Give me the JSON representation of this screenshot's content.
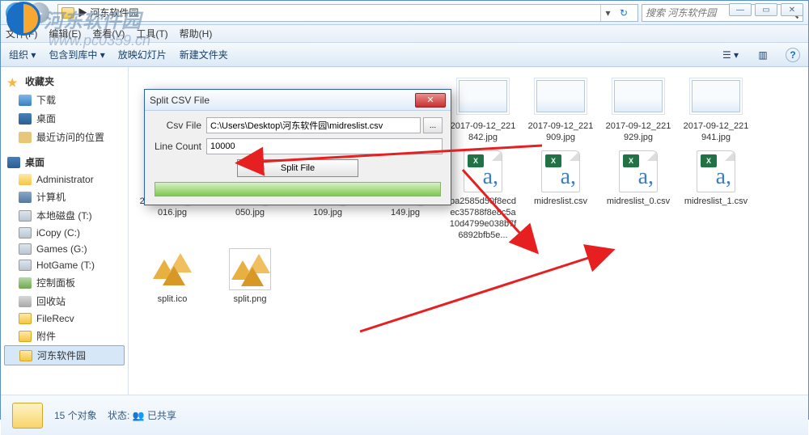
{
  "watermark": {
    "site": "河东软件园",
    "url": "www.pc0359.cn"
  },
  "window": {
    "address": "▶ 河东软件园",
    "search_placeholder": "搜索 河东软件园",
    "menus": [
      "文件(F)",
      "编辑(E)",
      "查看(V)",
      "工具(T)",
      "帮助(H)"
    ],
    "toolbar": {
      "organize": "组织 ▾",
      "include": "包含到库中 ▾",
      "slideshow": "放映幻灯片",
      "newfolder": "新建文件夹"
    }
  },
  "sidebar": {
    "fav": {
      "header": "收藏夹",
      "items": [
        "下载",
        "桌面",
        "最近访问的位置"
      ]
    },
    "desk": {
      "header": "桌面",
      "items": [
        "Administrator",
        "计算机",
        "本地磁盘 (T:)",
        "iCopy (C:)",
        "Games (G:)",
        "HotGame (T:)",
        "控制面板",
        "回收站",
        "FileRecv",
        "附件",
        "河东软件园"
      ]
    }
  },
  "files": [
    {
      "name": "2017-09-12_221842.jpg",
      "type": "img"
    },
    {
      "name": "2017-09-12_221909.jpg",
      "type": "img"
    },
    {
      "name": "2017-09-12_221929.jpg",
      "type": "img"
    },
    {
      "name": "2017-09-12_221941.jpg",
      "type": "img"
    },
    {
      "name": "2017-09-12_222016.jpg",
      "type": "img"
    },
    {
      "name": "2017-09-12_222050.jpg",
      "type": "img"
    },
    {
      "name": "2017-09-12_222109.jpg",
      "type": "img"
    },
    {
      "name": "2017-09-12_222149.jpg",
      "type": "img"
    },
    {
      "name": "ba2585d50f8ecdec35788f8e8c5a10d4799e038b7f6892bfb5e...",
      "type": "csv"
    },
    {
      "name": "midreslist.csv",
      "type": "csv"
    },
    {
      "name": "midreslist_0.csv",
      "type": "csv"
    },
    {
      "name": "midreslist_1.csv",
      "type": "csv"
    },
    {
      "name": "split.ico",
      "type": "ico"
    },
    {
      "name": "split.png",
      "type": "png"
    }
  ],
  "dialog": {
    "title": "Split CSV File",
    "csv_label": "Csv File",
    "csv_value": "C:\\Users\\Desktop\\河东软件园\\midreslist.csv",
    "line_label": "Line Count",
    "line_value": "10000",
    "split_btn": "Split File"
  },
  "status": {
    "count": "15 个对象",
    "state_label": "状态:",
    "state_value": "已共享"
  }
}
